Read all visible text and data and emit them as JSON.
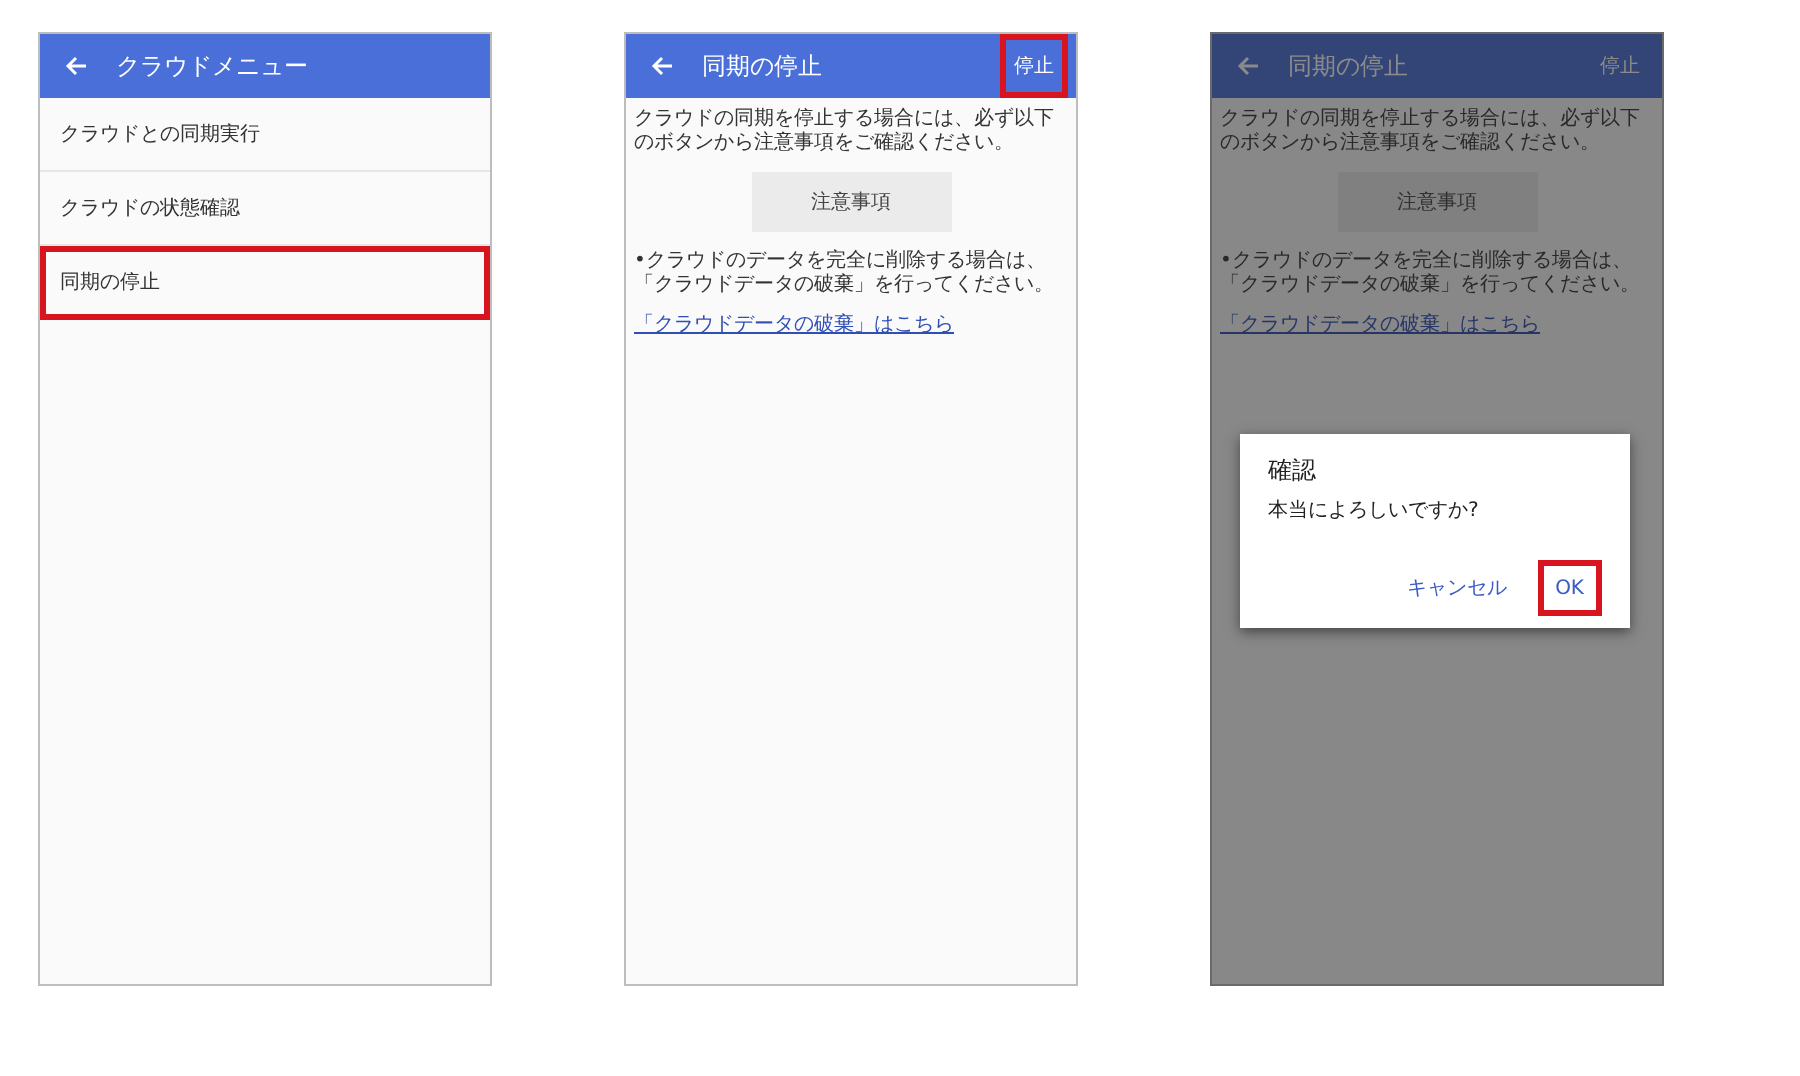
{
  "screens": [
    {
      "kind": "menu",
      "title": "クラウドメニュー",
      "items": [
        {
          "label": "クラウドとの同期実行",
          "highlighted": false
        },
        {
          "label": "クラウドの状態確認",
          "highlighted": false
        },
        {
          "label": "同期の停止",
          "highlighted": true
        }
      ]
    },
    {
      "kind": "notice",
      "title": "同期の停止",
      "action": {
        "label": "停止",
        "highlighted": true
      },
      "message": "クラウドの同期を停止する場合には、必ず以下のボタンから注意事項をご確認ください。",
      "button": "注意事項",
      "note": "•クラウドのデータを完全に削除する場合は、「クラウドデータの破棄」を行ってください。",
      "link": "「クラウドデータの破棄」はこちら"
    },
    {
      "kind": "notice",
      "title": "同期の停止",
      "action": {
        "label": "停止",
        "highlighted": false
      },
      "message": "クラウドの同期を停止する場合には、必ず以下のボタンから注意事項をご確認ください。",
      "button": "注意事項",
      "note": "•クラウドのデータを完全に削除する場合は、「クラウドデータの破棄」を行ってください。",
      "link": "「クラウドデータの破棄」はこちら",
      "dialog": {
        "title": "確認",
        "message": "本当によろしいですか?",
        "buttons": [
          {
            "label": "キャンセル",
            "highlighted": false
          },
          {
            "label": "OK",
            "highlighted": true
          }
        ]
      }
    }
  ]
}
